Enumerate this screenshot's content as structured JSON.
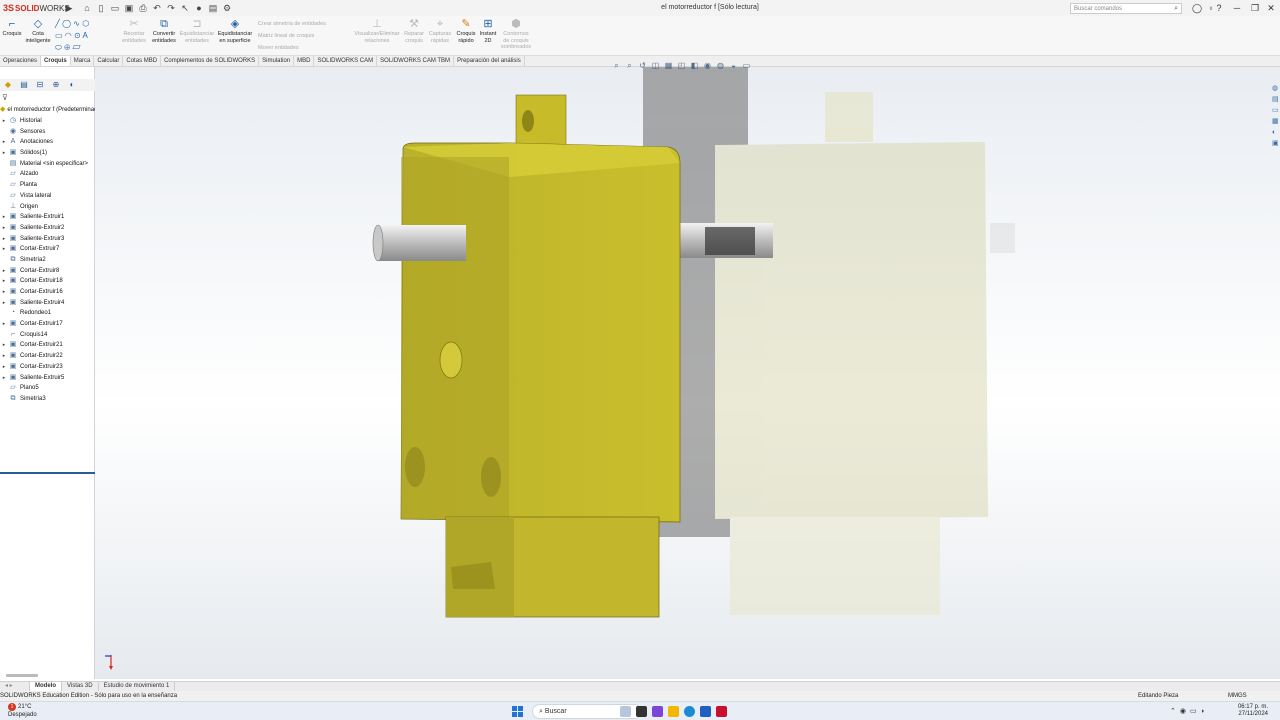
{
  "app": {
    "brand_ds": "3S",
    "brand_solid": "SOLID",
    "brand_works": "WORKS"
  },
  "window": {
    "title": "el motorreductor f [Sólo lectura]"
  },
  "search": {
    "placeholder": "Buscar comandos"
  },
  "ribbon": {
    "croquis": "Croquis",
    "cota": [
      "Cota",
      "inteligente"
    ],
    "recortar": [
      "Recortar",
      "entidades"
    ],
    "convertir": [
      "Convertir",
      "entidades"
    ],
    "equid_ent": [
      "Equidistanciar",
      "entidades"
    ],
    "equid_sup": [
      "Equidistanciar",
      "en superficie"
    ],
    "crear_simetria": "Crear simetría de entidades",
    "matriz_lineal": "Matriz lineal de croquis",
    "mover": "Mover entidades",
    "visualizar": [
      "Visualizar/Eliminar",
      "relaciones"
    ],
    "reparar": [
      "Reparar",
      "croquis"
    ],
    "capturas": [
      "Capturas",
      "rápidas"
    ],
    "croquis_rapido": [
      "Croquis",
      "rápido"
    ],
    "instant2d": [
      "Instant",
      "2D"
    ],
    "contornos": [
      "Contornos",
      "de croquis",
      "sombreados"
    ]
  },
  "command_tabs": [
    "Operaciones",
    "Croquis",
    "Marca",
    "Calcular",
    "Cotas MBD",
    "Complementos de SOLIDWORKS",
    "Simulation",
    "MBD",
    "SOLIDWORKS CAM",
    "SOLIDWORKS CAM TBM",
    "Preparación del análisis"
  ],
  "tree": [
    {
      "label": "el motorreductor f (Predeterminado)",
      "icon": "part",
      "expand": false,
      "root": true
    },
    {
      "label": "Historial",
      "icon": "history",
      "expand": true
    },
    {
      "label": "Sensores",
      "icon": "sensor",
      "expand": false
    },
    {
      "label": "Anotaciones",
      "icon": "annotation",
      "expand": true
    },
    {
      "label": "Sólidos(1)",
      "icon": "solid",
      "expand": true
    },
    {
      "label": "Material <sin especificar>",
      "icon": "material",
      "expand": false
    },
    {
      "label": "Alzado",
      "icon": "plane",
      "expand": false
    },
    {
      "label": "Planta",
      "icon": "plane",
      "expand": false
    },
    {
      "label": "Vista lateral",
      "icon": "plane",
      "expand": false
    },
    {
      "label": "Origen",
      "icon": "origin",
      "expand": false
    },
    {
      "label": "Saliente-Extruir1",
      "icon": "extrude",
      "expand": true
    },
    {
      "label": "Saliente-Extruir2",
      "icon": "extrude",
      "expand": true
    },
    {
      "label": "Saliente-Extruir3",
      "icon": "extrude",
      "expand": true
    },
    {
      "label": "Cortar-Extruir7",
      "icon": "cut",
      "expand": true
    },
    {
      "label": "Simetría2",
      "icon": "mirror",
      "expand": false
    },
    {
      "label": "Cortar-Extruir8",
      "icon": "cut",
      "expand": true
    },
    {
      "label": "Cortar-Extruir18",
      "icon": "cut",
      "expand": true
    },
    {
      "label": "Cortar-Extruir16",
      "icon": "cut",
      "expand": true
    },
    {
      "label": "Saliente-Extruir4",
      "icon": "extrude",
      "expand": true
    },
    {
      "label": "Redondeo1",
      "icon": "fillet",
      "expand": false
    },
    {
      "label": "Cortar-Extruir17",
      "icon": "cut",
      "expand": true
    },
    {
      "label": "Croquis14",
      "icon": "sketch",
      "expand": false
    },
    {
      "label": "Cortar-Extruir21",
      "icon": "cut",
      "expand": true
    },
    {
      "label": "Cortar-Extruir22",
      "icon": "cut",
      "expand": true
    },
    {
      "label": "Cortar-Extruir23",
      "icon": "cut",
      "expand": true
    },
    {
      "label": "Saliente-Extruir5",
      "icon": "extrude",
      "expand": true
    },
    {
      "label": "Plano5",
      "icon": "plane",
      "expand": false
    },
    {
      "label": "Simetría3",
      "icon": "mirror",
      "expand": false
    }
  ],
  "bottom_tabs": [
    "Modelo",
    "Vistas 3D",
    "Estudio de movimiento 1"
  ],
  "status": {
    "left": "SOLIDWORKS Education Edition - Sólo para uso en la enseñanza",
    "mode": "Editando Pieza",
    "units": "MMGS"
  },
  "taskbar": {
    "temp": "21°C",
    "weather": "Despejado",
    "search": "Buscar",
    "time": "06:17 p. m.",
    "date": "27/11/2024",
    "notif": "1"
  },
  "colors": {
    "accent": "#d52b1e",
    "model_yellow": "#c9bf2c",
    "tree_select": "#2a5c9a"
  }
}
